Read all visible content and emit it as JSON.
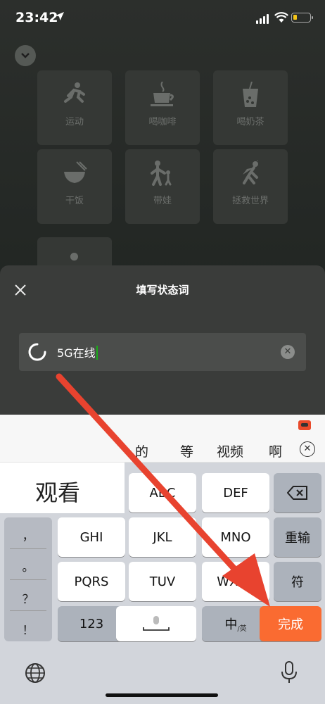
{
  "status_bar": {
    "time": "23:42",
    "location_icon": "location-arrow-icon",
    "signal_icon": "signal-bars-icon",
    "wifi_icon": "wifi-icon",
    "battery_icon": "battery-low-icon",
    "battery_color": "#f5c518"
  },
  "tiles": [
    {
      "label": "运动",
      "icon": "running-icon"
    },
    {
      "label": "喝咖啡",
      "icon": "coffee-cup-icon"
    },
    {
      "label": "喝奶茶",
      "icon": "bubble-tea-icon"
    },
    {
      "label": "干饭",
      "icon": "rice-bowl-icon"
    },
    {
      "label": "带娃",
      "icon": "parent-child-icon"
    },
    {
      "label": "拯救世界",
      "icon": "superhero-icon"
    }
  ],
  "sheet": {
    "title": "填写状态词",
    "input_value": "5G在线"
  },
  "keyboard": {
    "candidates": [
      "的",
      "等",
      "视频",
      "啊"
    ],
    "composing": "观看",
    "keys": {
      "abc": "ABC",
      "def": "DEF",
      "ghi": "GHI",
      "jkl": "JKL",
      "mno": "MNO",
      "pqrs": "PQRS",
      "tuv": "TUV",
      "wxyz": "WXYZ",
      "num": "123",
      "lang": "中",
      "reinput": "重输",
      "symbols": "符",
      "done": "完成"
    },
    "punctuation": [
      "，",
      "。",
      "？",
      "！"
    ],
    "done_color": "#fa6b31"
  },
  "annotation_color": "#e8432f"
}
